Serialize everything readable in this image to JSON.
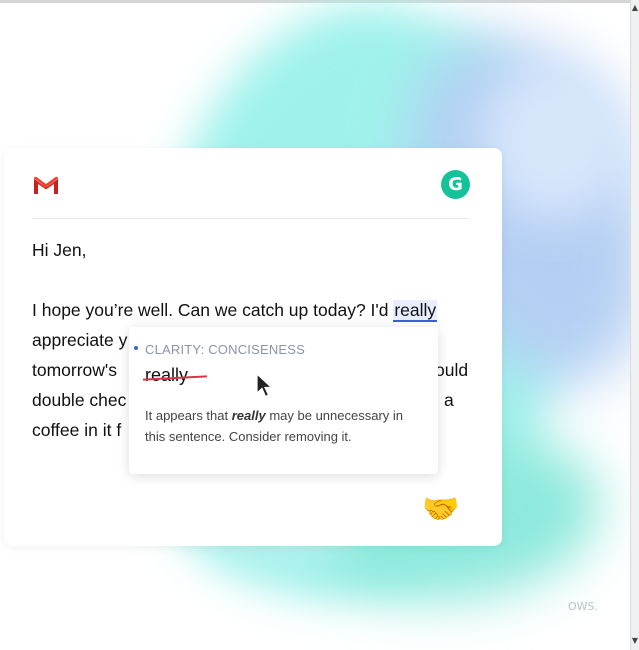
{
  "email": {
    "greeting": "Hi Jen,",
    "line1_before": "I hope you’re well. Can we catch up today? I'd ",
    "line1_highlight": "really",
    "line2": "appreciate y",
    "line3_left": "tomorrow's",
    "line3_right": "ould",
    "line4_left": "double chec",
    "line4_right": "a",
    "line5": "coffee in it f"
  },
  "suggestion": {
    "category": "CLARITY: CONCISENESS",
    "word": "really",
    "explain_before": "It appears that ",
    "explain_word": "really",
    "explain_after": " may be unnecessary in this sentence. Consider removing it."
  },
  "icons": {
    "gmail": "gmail-logo-icon",
    "grammarly": "grammarly-logo-icon",
    "emoji": "handshake-icon",
    "cursor": "mouse-pointer-icon"
  },
  "emoji": "🤝",
  "grammarly_letter": "G",
  "watermark": "OWS.",
  "colors": {
    "grammarly_green": "#15c39a",
    "highlight_underline": "#3d5fd8",
    "strike": "#d8344c"
  }
}
